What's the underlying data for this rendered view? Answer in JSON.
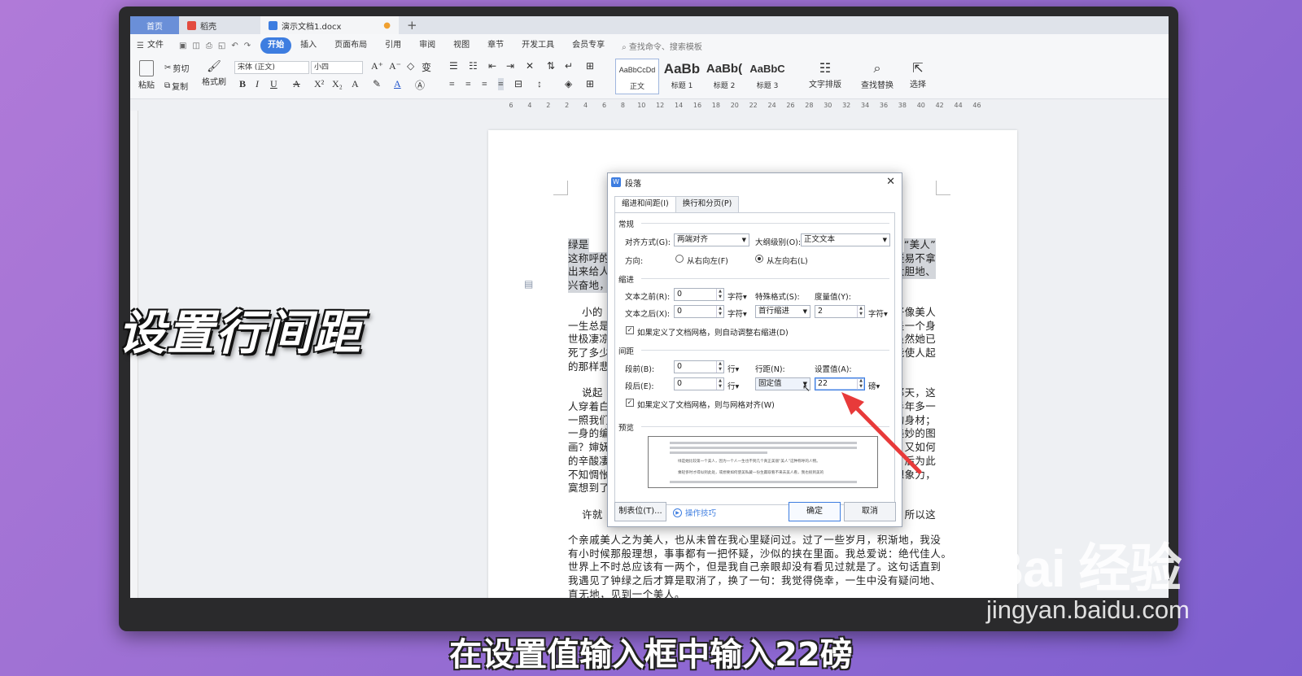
{
  "tabs": {
    "home": "首页",
    "app": "稻壳",
    "doc": "演示文档1.docx"
  },
  "menu": {
    "file": "文件",
    "items": [
      "开始",
      "插入",
      "页面布局",
      "引用",
      "审阅",
      "视图",
      "章节",
      "开发工具",
      "会员专享"
    ],
    "search": "查找命令、搜索模板"
  },
  "ribbon": {
    "paste": "粘贴",
    "cut": "剪切",
    "copy": "复制",
    "format_painter": "格式刷",
    "font_name": "宋体 (正文)",
    "font_size": "小四",
    "styles": [
      {
        "sample": "AaBbCcDd",
        "label": "正文"
      },
      {
        "sample": "AaBb",
        "label": "标题 1"
      },
      {
        "sample": "AaBb(",
        "label": "标题 2"
      },
      {
        "sample": "AaBbC",
        "label": "标题 3"
      }
    ],
    "text_layout": "文字排版",
    "find_replace": "查找替换",
    "select": "选择"
  },
  "ruler": {
    "marks": [
      "6",
      "4",
      "2",
      "2",
      "4",
      "6",
      "8",
      "10",
      "12",
      "14",
      "16",
      "18",
      "20",
      "22",
      "24",
      "26",
      "28",
      "30",
      "32",
      "34",
      "36",
      "38",
      "40",
      "42",
      "44",
      "46"
    ]
  },
  "document": {
    "lines_left": [
      "绿是",
      "这称呼的",
      "出来给人",
      "兴奋地，",
      "    小的",
      "一生总是",
      "世极凄凉",
      "死了多少",
      "的那样悲",
      "    说起",
      "人穿着白",
      "一照我们",
      "一身的编",
      "画？婶妩",
      "的辛酸凄",
      "不知惆怅",
      "寞想到了",
      "    许就"
    ],
    "lines_right": [
      "“美人”",
      "轻易不拿",
      "大胆地、",
      "好像美人",
      "是一个身",
      "虽然她已",
      "能使人起",
      "那天，这",
      "半年多一",
      "的身材；",
      "美妙的图",
      "又如何",
      "后为此",
      "想象力，",
      "，所以这"
    ],
    "bottom_lines": [
      "个亲戚美人之为美人，也从未曾在我心里疑问过。过了一些岁月，积渐地，我没",
      "有小时候那般理想，事事都有一把怀疑，沙似的挟在里面。我总爱说：绝代佳人。",
      "世界上不时总应该有一两个，但是我自己亲眼却没有看见过就是了。这句话直到",
      "我遇见了钟绿之后才算是取消了，换了一句：我觉得侥幸，一生中没有疑问地、",
      "直无地，见到一个美人。"
    ]
  },
  "dialog": {
    "title": "段落",
    "tabs": [
      "缩进和间距(I)",
      "换行和分页(P)"
    ],
    "general": {
      "section": "常规",
      "alignment_label": "对齐方式(G):",
      "alignment_value": "两端对齐",
      "outline_label": "大纲级别(O):",
      "outline_value": "正文文本",
      "direction_label": "方向:",
      "rtl": "从右向左(F)",
      "ltr": "从左向右(L)"
    },
    "indent": {
      "section": "缩进",
      "before_label": "文本之前(R):",
      "before_value": "0",
      "after_label": "文本之后(X):",
      "after_value": "0",
      "unit": "字符",
      "special_label": "特殊格式(S):",
      "special_value": "首行缩进",
      "measure_label": "度量值(Y):",
      "measure_value": "2",
      "measure_unit": "字符",
      "auto_adjust": "如果定义了文档网格，则自动调整右缩进(D)"
    },
    "spacing": {
      "section": "间距",
      "before_label": "段前(B):",
      "before_value": "0",
      "after_label": "段后(E):",
      "after_value": "0",
      "unit": "行",
      "line_label": "行距(N):",
      "line_value": "固定值",
      "set_label": "设置值(A):",
      "set_value": "22",
      "set_unit": "磅",
      "snap_grid": "如果定义了文档网格，则与网格对齐(W)"
    },
    "preview": {
      "section": "预览",
      "line1": "绿是她比较第一个美人，因为一个人一生也不到几个真正美丽“美人”这种称呼的人物。",
      "line2": "乘轻侈时才得似到此处，或想要如何使美私藏一份生赢取看不来去美人看，我也很到美的"
    },
    "buttons": {
      "tabs": "制表位(T)...",
      "tips": "操作技巧",
      "ok": "确定",
      "cancel": "取消"
    }
  },
  "overlay": {
    "caption": "设置行间距",
    "subtitle": "在设置值输入框中输入22磅",
    "watermark_brand": "Bai 经验",
    "watermark_url": "jingyan.baidu.com"
  },
  "colors": {
    "accent": "#3d7de0",
    "arrow": "#e83a3a",
    "background": "#9b6fd3"
  }
}
